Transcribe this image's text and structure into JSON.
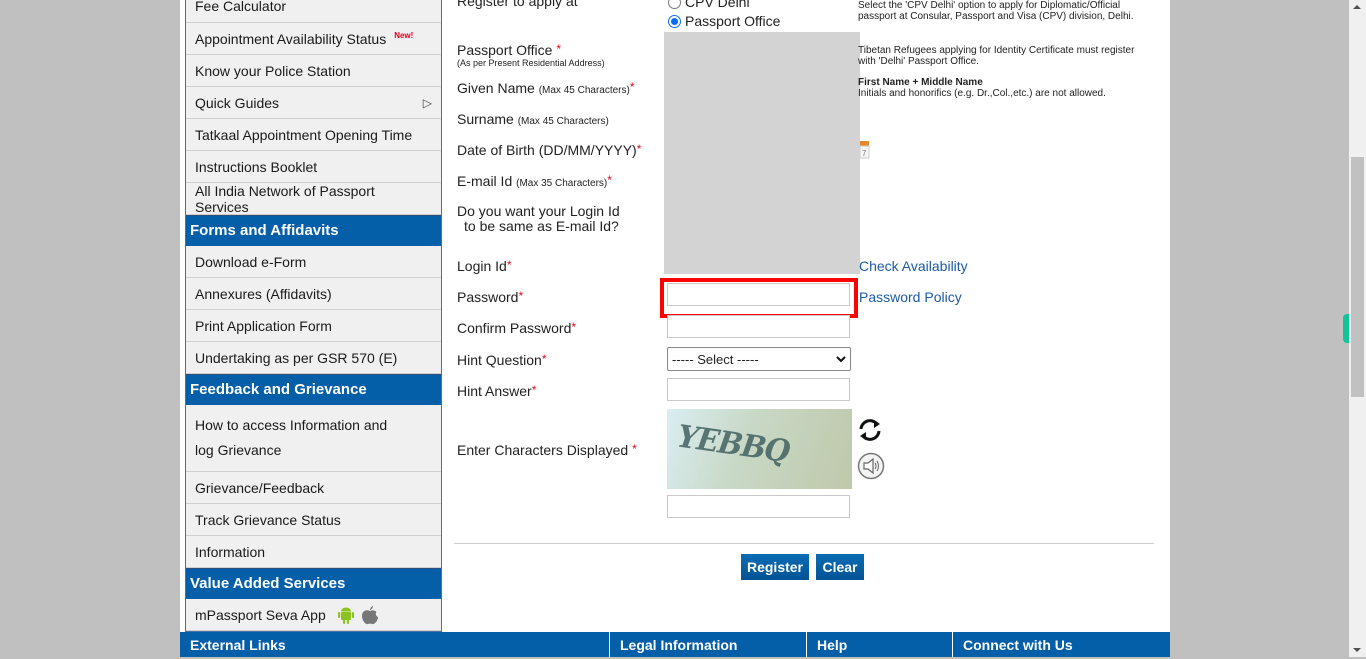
{
  "sidebar": {
    "items_top": [
      {
        "label": "Fee Calculator"
      },
      {
        "label": "Appointment Availability Status",
        "badge": "New!"
      },
      {
        "label": "Know your Police Station"
      },
      {
        "label": "Quick Guides",
        "submenu": true
      },
      {
        "label": "Tatkaal Appointment Opening Time"
      },
      {
        "label": "Instructions Booklet"
      },
      {
        "label": "All India Network of Passport Services"
      }
    ],
    "forms_heading": "Forms and Affidavits",
    "forms_items": [
      {
        "label": "Download e-Form"
      },
      {
        "label": "Annexures (Affidavits)"
      },
      {
        "label": "Print Application Form"
      },
      {
        "label": "Undertaking as per GSR 570 (E)"
      }
    ],
    "feedback_heading": "Feedback and Grievance",
    "feedback_items": [
      {
        "label": "How to access Information and log Grievance"
      },
      {
        "label": "Grievance/Feedback"
      },
      {
        "label": "Track Grievance Status"
      },
      {
        "label": "Information"
      }
    ],
    "vas_heading": "Value Added Services",
    "vas_items": [
      {
        "label": "mPassport Seva App",
        "icons": [
          "android-icon",
          "apple-icon"
        ]
      }
    ]
  },
  "form": {
    "register_at_label": "Register to apply at",
    "register_options": [
      {
        "label": "CPV Delhi",
        "selected": false
      },
      {
        "label": "Passport Office",
        "selected": true
      }
    ],
    "passport_office_label": "Passport Office",
    "passport_office_sub": "(As per Present Residential Address)",
    "given_name_label": "Given Name",
    "given_name_sub": "(Max 45 Characters)",
    "surname_label": "Surname",
    "surname_sub": "(Max 45 Characters)",
    "dob_label": "Date of Birth (DD/MM/YYYY)",
    "email_label": "E-mail Id",
    "email_sub": "(Max 35 Characters)",
    "login_same_label_1": "Do you want your Login Id",
    "login_same_label_2": "to be same as E-mail Id?",
    "login_id_label": "Login Id",
    "password_label": "Password",
    "confirm_password_label": "Confirm Password",
    "hint_question_label": "Hint Question",
    "hint_question_value": "----- Select -----",
    "hint_answer_label": "Hint Answer",
    "captcha_label": "Enter Characters Displayed",
    "captcha_text": "YEBBQ",
    "required_mark": "*",
    "check_availability": "Check Availability",
    "password_policy": "Password Policy",
    "register_button": "Register",
    "clear_button": "Clear",
    "values": {
      "password": "",
      "confirm_password": "",
      "hint_answer": "",
      "captcha": ""
    }
  },
  "hints": {
    "cpv": "Select the 'CPV Delhi' option to apply for Diplomatic/Official passport at Consular, Passport and Visa (CPV) division, Delhi.",
    "tibetan": "Tibetan Refugees applying for Identity Certificate must register with 'Delhi' Passport Office.",
    "name_title": "First Name + Middle Name",
    "name_note": "Initials and honorifics (e.g. Dr.,Col.,etc.) are not allowed."
  },
  "footer": {
    "columns": [
      "External Links",
      "Legal Information",
      "Help",
      "Connect with Us"
    ]
  },
  "colors": {
    "brand_blue": "#045ea8",
    "required_red": "#e8001c",
    "highlight_red": "#ff0000",
    "link_blue": "#1d5aa5"
  }
}
